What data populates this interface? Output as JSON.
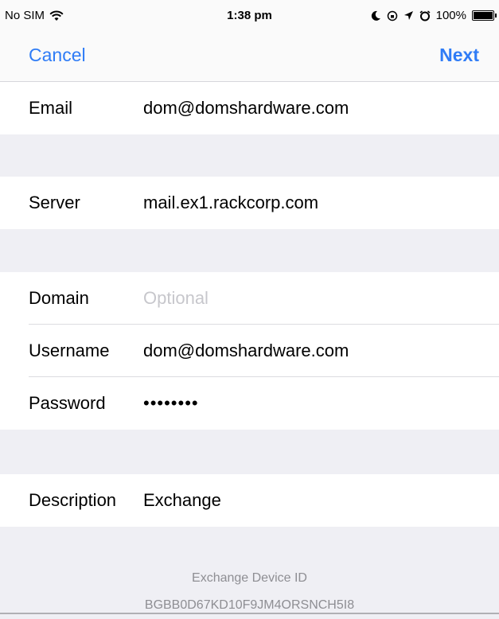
{
  "status_bar": {
    "carrier": "No SIM",
    "time": "1:38 pm",
    "battery": "100%"
  },
  "nav": {
    "cancel": "Cancel",
    "next": "Next"
  },
  "form": {
    "email": {
      "label": "Email",
      "value": "dom@domshardware.com"
    },
    "server": {
      "label": "Server",
      "value": "mail.ex1.rackcorp.com"
    },
    "domain": {
      "label": "Domain",
      "value": "",
      "placeholder": "Optional"
    },
    "username": {
      "label": "Username",
      "value": "dom@domshardware.com"
    },
    "password": {
      "label": "Password",
      "value": "••••••••"
    },
    "description": {
      "label": "Description",
      "value": "Exchange"
    }
  },
  "footer": {
    "title": "Exchange Device ID",
    "device_id": "BGBB0D67KD10F9JM4ORSNCH5I8"
  }
}
